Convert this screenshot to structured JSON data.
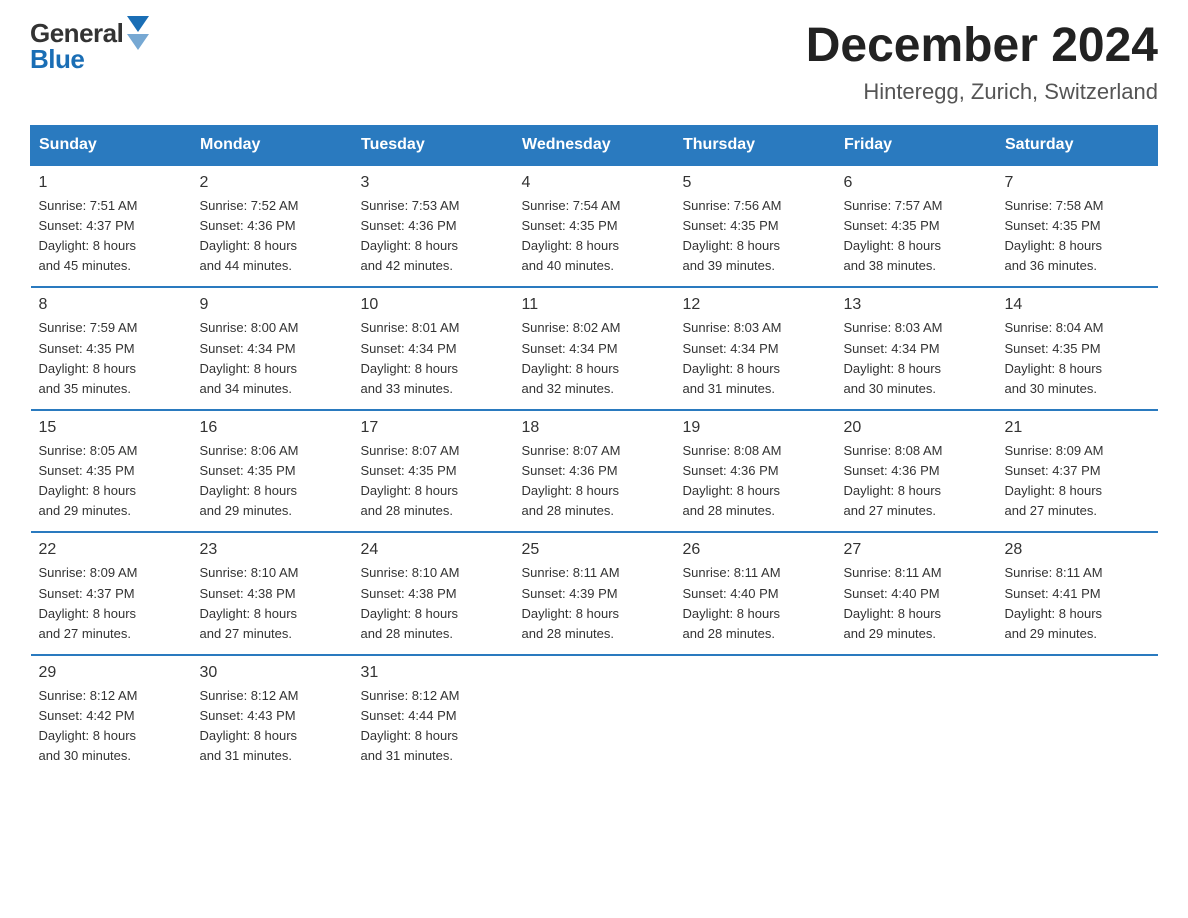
{
  "header": {
    "logo_line1": "General",
    "logo_line2": "Blue",
    "month_year": "December 2024",
    "location": "Hinteregg, Zurich, Switzerland"
  },
  "weekdays": [
    "Sunday",
    "Monday",
    "Tuesday",
    "Wednesday",
    "Thursday",
    "Friday",
    "Saturday"
  ],
  "weeks": [
    [
      {
        "day": "1",
        "sunrise": "7:51 AM",
        "sunset": "4:37 PM",
        "daylight": "8 hours and 45 minutes."
      },
      {
        "day": "2",
        "sunrise": "7:52 AM",
        "sunset": "4:36 PM",
        "daylight": "8 hours and 44 minutes."
      },
      {
        "day": "3",
        "sunrise": "7:53 AM",
        "sunset": "4:36 PM",
        "daylight": "8 hours and 42 minutes."
      },
      {
        "day": "4",
        "sunrise": "7:54 AM",
        "sunset": "4:35 PM",
        "daylight": "8 hours and 40 minutes."
      },
      {
        "day": "5",
        "sunrise": "7:56 AM",
        "sunset": "4:35 PM",
        "daylight": "8 hours and 39 minutes."
      },
      {
        "day": "6",
        "sunrise": "7:57 AM",
        "sunset": "4:35 PM",
        "daylight": "8 hours and 38 minutes."
      },
      {
        "day": "7",
        "sunrise": "7:58 AM",
        "sunset": "4:35 PM",
        "daylight": "8 hours and 36 minutes."
      }
    ],
    [
      {
        "day": "8",
        "sunrise": "7:59 AM",
        "sunset": "4:35 PM",
        "daylight": "8 hours and 35 minutes."
      },
      {
        "day": "9",
        "sunrise": "8:00 AM",
        "sunset": "4:34 PM",
        "daylight": "8 hours and 34 minutes."
      },
      {
        "day": "10",
        "sunrise": "8:01 AM",
        "sunset": "4:34 PM",
        "daylight": "8 hours and 33 minutes."
      },
      {
        "day": "11",
        "sunrise": "8:02 AM",
        "sunset": "4:34 PM",
        "daylight": "8 hours and 32 minutes."
      },
      {
        "day": "12",
        "sunrise": "8:03 AM",
        "sunset": "4:34 PM",
        "daylight": "8 hours and 31 minutes."
      },
      {
        "day": "13",
        "sunrise": "8:03 AM",
        "sunset": "4:34 PM",
        "daylight": "8 hours and 30 minutes."
      },
      {
        "day": "14",
        "sunrise": "8:04 AM",
        "sunset": "4:35 PM",
        "daylight": "8 hours and 30 minutes."
      }
    ],
    [
      {
        "day": "15",
        "sunrise": "8:05 AM",
        "sunset": "4:35 PM",
        "daylight": "8 hours and 29 minutes."
      },
      {
        "day": "16",
        "sunrise": "8:06 AM",
        "sunset": "4:35 PM",
        "daylight": "8 hours and 29 minutes."
      },
      {
        "day": "17",
        "sunrise": "8:07 AM",
        "sunset": "4:35 PM",
        "daylight": "8 hours and 28 minutes."
      },
      {
        "day": "18",
        "sunrise": "8:07 AM",
        "sunset": "4:36 PM",
        "daylight": "8 hours and 28 minutes."
      },
      {
        "day": "19",
        "sunrise": "8:08 AM",
        "sunset": "4:36 PM",
        "daylight": "8 hours and 28 minutes."
      },
      {
        "day": "20",
        "sunrise": "8:08 AM",
        "sunset": "4:36 PM",
        "daylight": "8 hours and 27 minutes."
      },
      {
        "day": "21",
        "sunrise": "8:09 AM",
        "sunset": "4:37 PM",
        "daylight": "8 hours and 27 minutes."
      }
    ],
    [
      {
        "day": "22",
        "sunrise": "8:09 AM",
        "sunset": "4:37 PM",
        "daylight": "8 hours and 27 minutes."
      },
      {
        "day": "23",
        "sunrise": "8:10 AM",
        "sunset": "4:38 PM",
        "daylight": "8 hours and 27 minutes."
      },
      {
        "day": "24",
        "sunrise": "8:10 AM",
        "sunset": "4:38 PM",
        "daylight": "8 hours and 28 minutes."
      },
      {
        "day": "25",
        "sunrise": "8:11 AM",
        "sunset": "4:39 PM",
        "daylight": "8 hours and 28 minutes."
      },
      {
        "day": "26",
        "sunrise": "8:11 AM",
        "sunset": "4:40 PM",
        "daylight": "8 hours and 28 minutes."
      },
      {
        "day": "27",
        "sunrise": "8:11 AM",
        "sunset": "4:40 PM",
        "daylight": "8 hours and 29 minutes."
      },
      {
        "day": "28",
        "sunrise": "8:11 AM",
        "sunset": "4:41 PM",
        "daylight": "8 hours and 29 minutes."
      }
    ],
    [
      {
        "day": "29",
        "sunrise": "8:12 AM",
        "sunset": "4:42 PM",
        "daylight": "8 hours and 30 minutes."
      },
      {
        "day": "30",
        "sunrise": "8:12 AM",
        "sunset": "4:43 PM",
        "daylight": "8 hours and 31 minutes."
      },
      {
        "day": "31",
        "sunrise": "8:12 AM",
        "sunset": "4:44 PM",
        "daylight": "8 hours and 31 minutes."
      },
      null,
      null,
      null,
      null
    ]
  ],
  "labels": {
    "sunrise": "Sunrise:",
    "sunset": "Sunset:",
    "daylight": "Daylight:"
  }
}
